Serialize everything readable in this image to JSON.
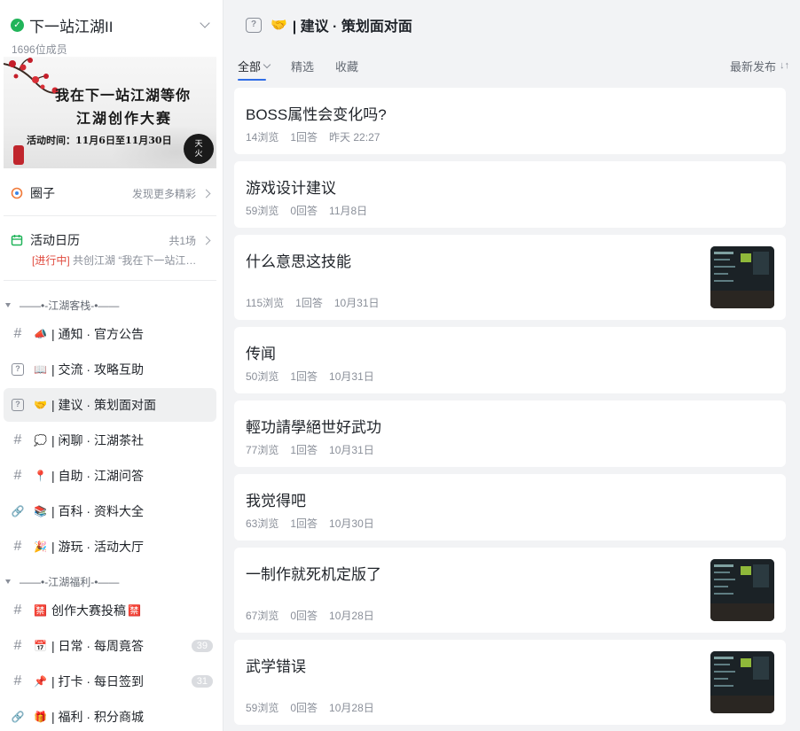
{
  "server": {
    "name": "下一站江湖II",
    "members": "1696位成员"
  },
  "banner": {
    "line1": "我在下一站江湖等你",
    "line2": "江湖创作大赛",
    "line3": "活动时间：11月6日至11月30日"
  },
  "sidebar": {
    "circle_label": "圈子",
    "circle_right": "发现更多精彩",
    "calendar_label": "活动日历",
    "calendar_count": "共1场",
    "calendar_tag": "[进行中]",
    "calendar_desc": "共创江湖 “我在下一站江…",
    "categories": [
      {
        "label": "——•-江湖客栈-•——"
      },
      {
        "label": "——•-江湖福利-•——"
      }
    ],
    "channels": [
      {
        "type": "#",
        "emoji": "📣",
        "name": "| 通知 · 官方公告"
      },
      {
        "type": "?",
        "emoji": "📖",
        "name": "| 交流 · 攻略互助"
      },
      {
        "type": "?",
        "emoji": "🤝",
        "name": "| 建议 · 策划面对面",
        "active": true
      },
      {
        "type": "#",
        "emoji": "💭",
        "name": "| 闲聊 · 江湖茶社"
      },
      {
        "type": "#",
        "emoji": "📍",
        "name": "| 自助 · 江湖问答"
      },
      {
        "type": "link",
        "emoji": "📚",
        "name": "| 百科 · 资料大全"
      },
      {
        "type": "#",
        "emoji": "🎉",
        "name": "| 游玩 · 活动大厅"
      },
      {
        "type": "#",
        "emoji": "🈲",
        "name": "创作大赛投稿",
        "emoji_after": "🈲"
      },
      {
        "type": "#",
        "emoji": "📅",
        "name": "| 日常 · 每周竟答",
        "badge": "39"
      },
      {
        "type": "#",
        "emoji": "📌",
        "name": "| 打卡 · 每日签到",
        "badge": "31"
      },
      {
        "type": "link",
        "emoji": "🎁",
        "name": "| 福利 · 积分商城"
      }
    ]
  },
  "header": {
    "title": "| 建议 · 策划面对面"
  },
  "tabs": {
    "all": "全部",
    "featured": "精选",
    "favorites": "收藏",
    "sort": "最新发布"
  },
  "posts": [
    {
      "title": "BOSS属性会变化吗?",
      "views": "14浏览",
      "answers": "1回答",
      "time": "昨天 22:27"
    },
    {
      "title": "游戏设计建议",
      "views": "59浏览",
      "answers": "0回答",
      "time": "11月8日"
    },
    {
      "title": "什么意思这技能",
      "views": "115浏览",
      "answers": "1回答",
      "time": "10月31日",
      "thumb": true
    },
    {
      "title": "传闻",
      "views": "50浏览",
      "answers": "1回答",
      "time": "10月31日"
    },
    {
      "title": "輕功請學絕世好武功",
      "views": "77浏览",
      "answers": "1回答",
      "time": "10月31日"
    },
    {
      "title": "我觉得吧",
      "views": "63浏览",
      "answers": "1回答",
      "time": "10月30日"
    },
    {
      "title": "一制作就死机定版了",
      "views": "67浏览",
      "answers": "0回答",
      "time": "10月28日",
      "thumb": true
    },
    {
      "title": "武学错误",
      "views": "59浏览",
      "answers": "0回答",
      "time": "10月28日",
      "thumb": true
    }
  ],
  "colors": {
    "accent": "#2f6de6",
    "verified": "#21b45a",
    "live_tag": "#e04b3f"
  }
}
